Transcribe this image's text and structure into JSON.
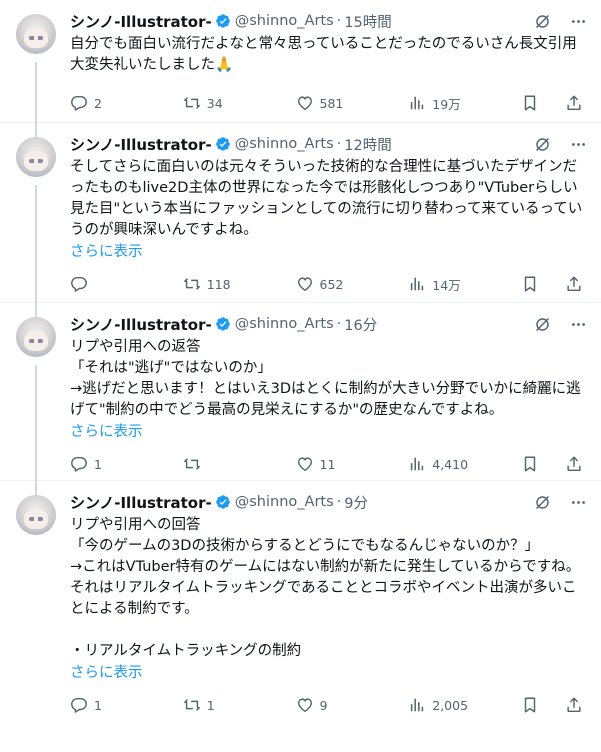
{
  "tweets": [
    {
      "author": "シンノ-Illustrator-",
      "handle": "@shinno_Arts",
      "time": "15時間",
      "text": "自分でも面白い流行だよなと常々思っていることだったのでるいさん長文引用大変失礼いたしました🙏",
      "show_more": "",
      "replies": "2",
      "reposts": "34",
      "likes": "581",
      "views": "19万"
    },
    {
      "author": "シンノ-Illustrator-",
      "handle": "@shinno_Arts",
      "time": "12時間",
      "text": "そしてさらに面白いのは元々そういった技術的な合理性に基づいたデザインだったものもlive2D主体の世界になった今では形骸化しつつあり\"VTuberらしい見た目\"という本当にファッションとしての流行に切り替わって来ているっていうのが興味深いんですよね。",
      "show_more": "さらに表示",
      "replies": "",
      "reposts": "118",
      "likes": "652",
      "views": "14万"
    },
    {
      "author": "シンノ-Illustrator-",
      "handle": "@shinno_Arts",
      "time": "16分",
      "text": "リプや引用への返答\n「それは\"逃げ\"ではないのか」\n→逃げだと思います！とはいえ3Dはとくに制約が大きい分野でいかに綺麗に逃げて\"制約の中でどう最高の見栄えにするか\"の歴史なんですよね。",
      "show_more": "さらに表示",
      "replies": "1",
      "reposts": "",
      "likes": "11",
      "views": "4,410"
    },
    {
      "author": "シンノ-Illustrator-",
      "handle": "@shinno_Arts",
      "time": "9分",
      "text": "リプや引用への回答\n「今のゲームの3Dの技術からするとどうにでもなるんじゃないのか？」\n→これはVTuber特有のゲームにはない制約が新たに発生しているからですね。\nそれはリアルタイムトラッキングであることとコラボやイベント出演が多いことによる制約です。\n\n・リアルタイムトラッキングの制約",
      "show_more": "さらに表示",
      "replies": "1",
      "reposts": "1",
      "likes": "9",
      "views": "2,005"
    }
  ],
  "dot": "·",
  "colors": {
    "accent": "#1d9bf0",
    "muted": "#536471",
    "text": "#0f1419"
  }
}
